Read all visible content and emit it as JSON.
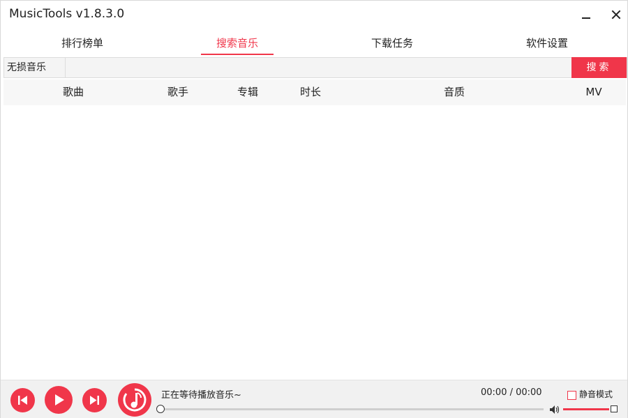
{
  "window": {
    "title": "MusicTools v1.8.3.0"
  },
  "tabs": [
    {
      "label": "排行榜单",
      "active": false
    },
    {
      "label": "搜索音乐",
      "active": true
    },
    {
      "label": "下载任务",
      "active": false
    },
    {
      "label": "软件设置",
      "active": false
    }
  ],
  "search": {
    "type_label": "无损音乐",
    "query": "",
    "placeholder": "",
    "button_label": "搜索"
  },
  "table": {
    "columns": [
      "歌曲",
      "歌手",
      "专辑",
      "时长",
      "音质",
      "MV"
    ],
    "rows": []
  },
  "player": {
    "status_text": "正在等待播放音乐~",
    "time_text": "00:00 / 00:00",
    "progress": 0,
    "volume": 1.0,
    "mute_label": "静音模式",
    "mute_checked": false
  },
  "colors": {
    "accent": "#f0364a",
    "background": "#ffffff",
    "header_bg": "#f7f7f7",
    "player_bg": "#f1f1f1"
  },
  "icons": [
    "minimize-icon",
    "close-icon",
    "previous-icon",
    "play-icon",
    "next-icon",
    "music-note-icon",
    "volume-icon"
  ]
}
